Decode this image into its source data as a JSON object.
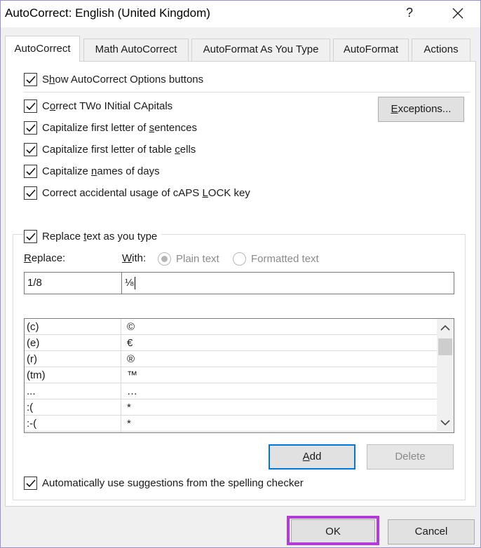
{
  "window": {
    "title": "AutoCorrect: English (United Kingdom)",
    "help": "?"
  },
  "tabs": [
    {
      "label": "AutoCorrect",
      "active": true
    },
    {
      "label": "Math AutoCorrect",
      "active": false
    },
    {
      "label": "AutoFormat As You Type",
      "active": false
    },
    {
      "label": "AutoFormat",
      "active": false
    },
    {
      "label": "Actions",
      "active": false
    }
  ],
  "options": {
    "show_buttons": {
      "pre": "S",
      "ul": "h",
      "post": "ow AutoCorrect Options buttons",
      "checked": true
    },
    "two_initials": {
      "pre": "C",
      "ul": "o",
      "post": "rrect TWo INitial CApitals",
      "checked": true
    },
    "first_sentence": {
      "pre": "Capitalize first letter of ",
      "ul": "s",
      "post": "entences",
      "checked": true
    },
    "table_cells": {
      "pre": "Capitalize first letter of table ",
      "ul": "c",
      "post": "ells",
      "checked": true
    },
    "names_days": {
      "pre": "Capitalize ",
      "ul": "n",
      "post": "ames of days",
      "checked": true
    },
    "caps_lock": {
      "pre": "Correct accidental usage of cAPS ",
      "ul": "L",
      "post": "OCK key",
      "checked": true
    }
  },
  "exceptions_button": {
    "ul": "E",
    "post": "xceptions..."
  },
  "replace_group": {
    "replace_text": {
      "pre": "Replace ",
      "ul": "t",
      "post": "ext as you type",
      "checked": true
    },
    "replace_label": {
      "ul": "R",
      "post": "eplace:"
    },
    "with_label": {
      "ul": "W",
      "post": "ith:"
    },
    "plain_text": "Plain text",
    "formatted_text": "Formatted text",
    "replace_value": "1/8",
    "with_value": "⅛",
    "entries": [
      {
        "replace": "(c)",
        "with": "©"
      },
      {
        "replace": "(e)",
        "with": "€"
      },
      {
        "replace": "(r)",
        "with": "®"
      },
      {
        "replace": "(tm)",
        "with": "™"
      },
      {
        "replace": "...",
        "with": "…"
      },
      {
        "replace": ":(",
        "with": "*"
      },
      {
        "replace": ":-(",
        "with": "*"
      }
    ],
    "add": {
      "ul": "A",
      "post": "dd"
    },
    "delete": "Delete",
    "spelling": {
      "pre": "Automatically use suggestions from the spelling checker",
      "checked": true
    }
  },
  "footer": {
    "ok": "OK",
    "cancel": "Cancel"
  },
  "colors": {
    "highlight": "#b23bd9",
    "focus_border": "#0078d7"
  }
}
